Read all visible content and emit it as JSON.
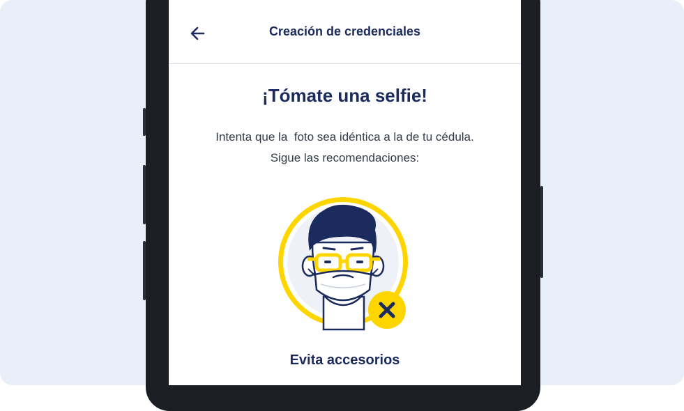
{
  "header": {
    "title": "Creación de credenciales",
    "back_icon": "arrow-left-icon"
  },
  "main": {
    "title": "¡Tómate una selfie!",
    "subtitle_line1": "Intenta que la  foto sea idéntica a la de tu cédula.",
    "subtitle_line2": "Sigue las recomendaciones:",
    "illustration_icon": "face-with-glasses-and-mask-icon",
    "status_icon": "close-x-icon",
    "caption": "Evita accesorios"
  },
  "colors": {
    "navy": "#1b2b5e",
    "yellow": "#ffd500",
    "background": "#e8eff8"
  }
}
